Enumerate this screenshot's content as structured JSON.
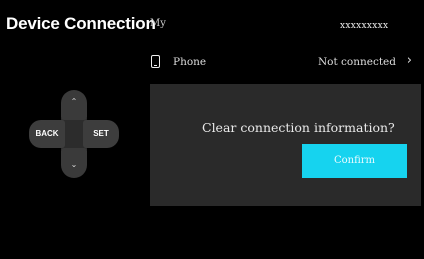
{
  "header": {
    "title": "Device Connection",
    "title_tail": "My",
    "device_id": "xxxxxxxxx"
  },
  "device_row": {
    "label": "Phone",
    "status": "Not connected",
    "chevron": "›",
    "icon": "phone-icon"
  },
  "dpad": {
    "left_label": "BACK",
    "right_label": "SET",
    "up_glyph": "⌃",
    "down_glyph": "⌄"
  },
  "dialog": {
    "message": "Clear connection information?",
    "confirm_label": "Confirm"
  },
  "colors": {
    "background": "#000000",
    "dialog_bg": "#2a2a2a",
    "accent": "#16d3ef",
    "dpad_button": "#3d3d3d"
  }
}
